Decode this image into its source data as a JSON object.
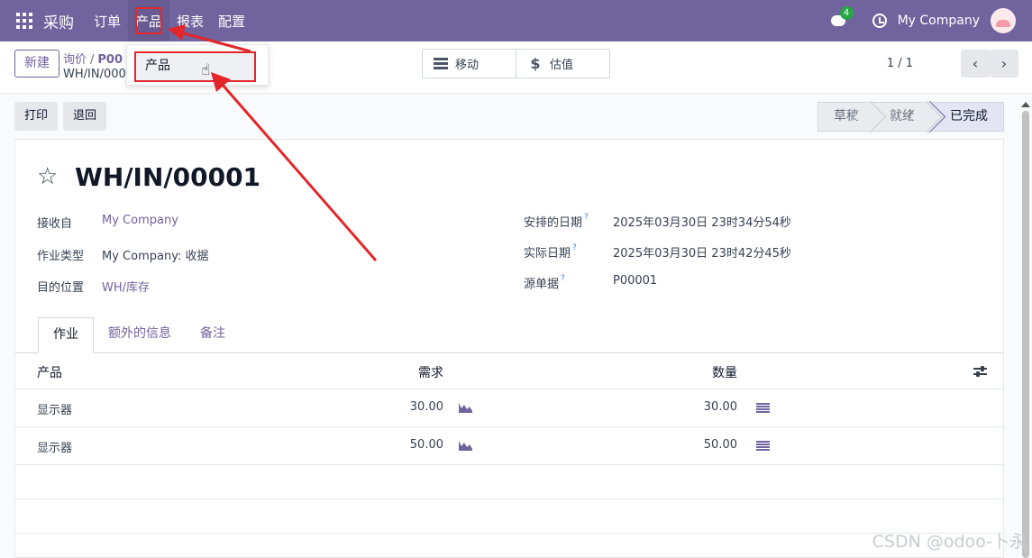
{
  "navbar": {
    "app_name": "采购",
    "menu": [
      "订单",
      "产品",
      "报表",
      "配置"
    ],
    "active_menu": "产品",
    "chat_badge": "4",
    "company": "My Company"
  },
  "control": {
    "new_label": "新建",
    "breadcrumb_parent": "询价",
    "breadcrumb_po": "P00",
    "breadcrumb_current": "WH/IN/000",
    "smart_buttons": [
      "移动",
      "估值"
    ],
    "pager": "1 / 1"
  },
  "dropdown": {
    "item": "产品"
  },
  "statusbar": {
    "buttons": [
      "打印",
      "退回"
    ],
    "stages": [
      "草稿",
      "就绪",
      "已完成"
    ],
    "current_stage": "已完成"
  },
  "record": {
    "title": "WH/IN/00001",
    "left_fields": [
      {
        "label": "接收自",
        "value": "My Company"
      },
      {
        "label": "作业类型",
        "value": "My Company: 收据"
      },
      {
        "label": "目的位置",
        "value": "WH/库存"
      }
    ],
    "right_fields": [
      {
        "label": "安排的日期",
        "value": "2025年03月30日 23时34分54秒"
      },
      {
        "label": "实际日期",
        "value": "2025年03月30日 23时42分45秒"
      },
      {
        "label": "源单据",
        "value": "P00001"
      }
    ],
    "help_mark": "?"
  },
  "tabs": [
    "作业",
    "额外的信息",
    "备注"
  ],
  "table": {
    "headers": [
      "产品",
      "需求",
      "数量"
    ],
    "rows": [
      {
        "product": "显示器",
        "demand": "30.00",
        "quantity": "30.00"
      },
      {
        "product": "显示器",
        "demand": "50.00",
        "quantity": "50.00"
      }
    ]
  },
  "watermark": "CSDN @odoo-卜永",
  "colors": {
    "brand": "#71639e",
    "annotation": "#e3262a",
    "badge": "#28a745"
  }
}
